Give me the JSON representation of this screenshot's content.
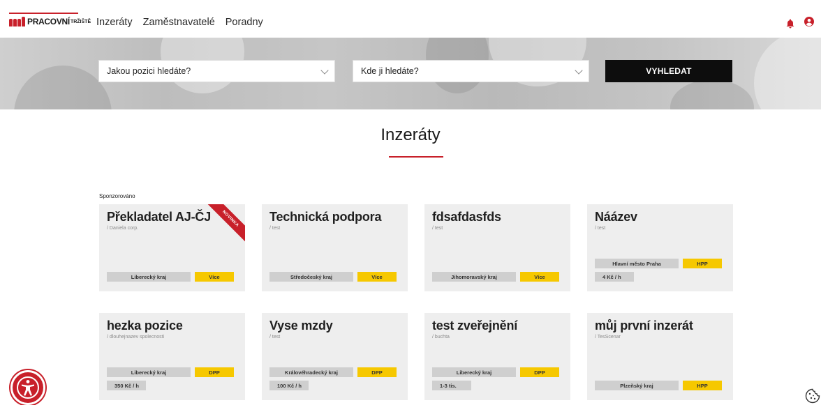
{
  "brand": {
    "logo_text": "PRACOVNÍ",
    "logo_sub": "TRŽIŠTĚ"
  },
  "nav": [
    "Inzeráty",
    "Zaměstnavatelé",
    "Poradny"
  ],
  "header_icons": [
    "bell-icon",
    "user-icon"
  ],
  "search": {
    "position_placeholder": "Jakou pozici hledáte?",
    "location_placeholder": "Kde ji hledáte?",
    "button_label": "VYHLEDAT"
  },
  "section": {
    "title": "Inzeráty",
    "sponsored_label": "Sponzorováno"
  },
  "colors": {
    "accent": "#c8202a",
    "badge_yellow": "#f6c800",
    "chip_grey": "#cfcfcf",
    "card_bg": "#eeeeee"
  },
  "cards": [
    {
      "title": "Překladatel AJ-ČJ",
      "company": "/ Daniela corp.",
      "region": "Liberecký kraj",
      "action": "Více",
      "ribbon": "NOVINKA"
    },
    {
      "title": "Technická podpora",
      "company": "/ test",
      "region": "Středočeský kraj",
      "action": "Více"
    },
    {
      "title": "fdsafdasfds",
      "company": "/ test",
      "region": "Jihomoravský kraj",
      "action": "Více"
    },
    {
      "title": "Náázev",
      "company": "/ test",
      "region": "Hlavní město Praha",
      "contract": "HPP",
      "salary": "4 Kč / h"
    },
    {
      "title": "hezka pozice",
      "company": "/ dlouhejnazev spolecnosti",
      "region": "Liberecký kraj",
      "contract": "DPP",
      "salary": "350 Kč / h"
    },
    {
      "title": "Vyse mzdy",
      "company": "/ test",
      "region": "Královéhradecký kraj",
      "contract": "DPP",
      "salary": "100 Kč / h"
    },
    {
      "title": "test zveřejnění",
      "company": "/ buchta",
      "region": "Liberecký kraj",
      "contract": "DPP",
      "salary": "1-3 tis."
    },
    {
      "title": "můj první inzerát",
      "company": "/ TesScenar",
      "region": "Plzeňský kraj",
      "contract": "HPP"
    }
  ]
}
